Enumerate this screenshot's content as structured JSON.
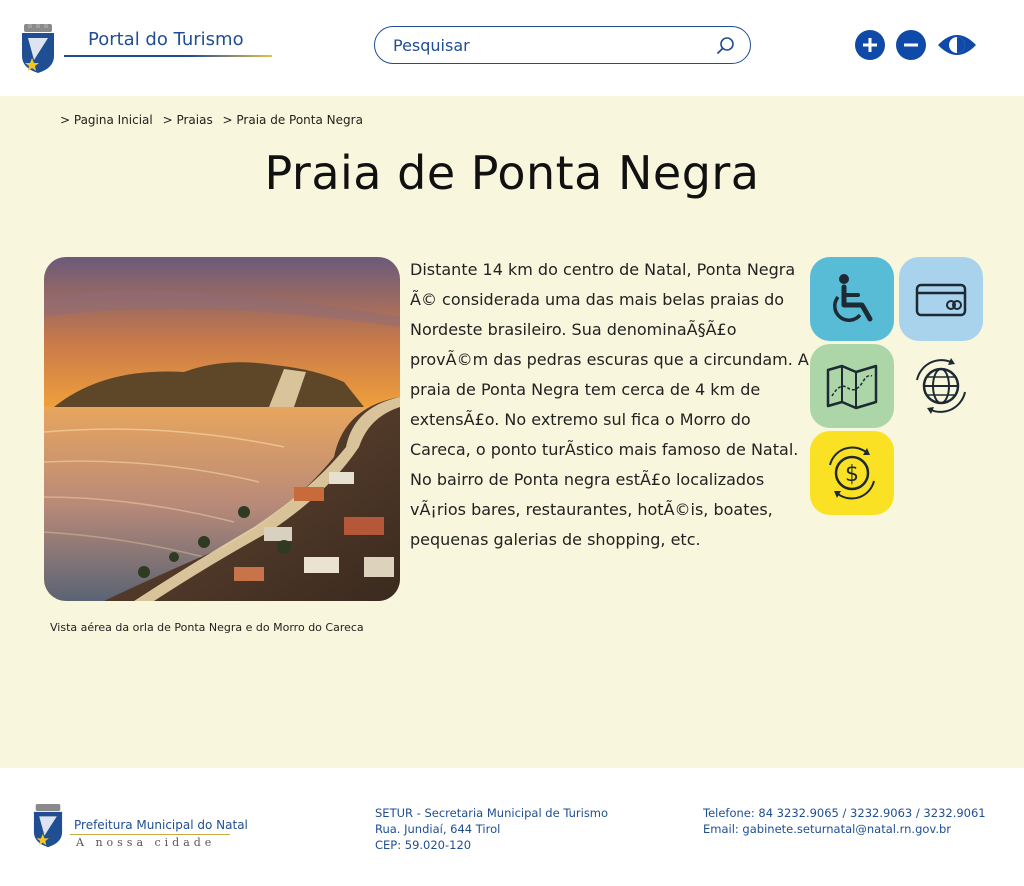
{
  "header": {
    "site_title": "Portal do Turismo",
    "search_placeholder": "Pesquisar",
    "controls": {
      "increase_font": "plus-icon",
      "decrease_font": "minus-icon",
      "contrast": "eye-icon"
    }
  },
  "breadcrumb": [
    "> Pagina Inicial",
    "> Praias",
    "> Praia de Ponta Negra"
  ],
  "page": {
    "title": "Praia de Ponta Negra",
    "description": "Distante 14 km do centro de Natal, Ponta Negra Ã© considerada uma das mais belas praias do Nordeste brasileiro. Sua denominaÃ§Ã£o provÃ©m das pedras escuras que a circundam. A praia de Ponta Negra tem cerca de 4 km de extensÃ£o. No extremo sul fica o Morro do Careca, o ponto turÃstico mais famoso de Natal. No bairro de Ponta negra estÃ£o localizados vÃ¡rios bares, restaurantes, hotÃ©is, boates, pequenas galerias de shopping, etc.",
    "photo_caption": "Vista aérea da orla de Ponta Negra e do Morro do Careca"
  },
  "feature_icons": [
    {
      "name": "accessibility-icon",
      "color": "#59bcd7"
    },
    {
      "name": "credit-card-icon",
      "color": "#a9d3ec"
    },
    {
      "name": "map-icon",
      "color": "#acd6a7"
    },
    {
      "name": "globe-icon",
      "color": "#f8f6dc"
    },
    {
      "name": "money-icon",
      "color": "#fbe124"
    }
  ],
  "footer": {
    "org_name": "Prefeitura Municipal do Natal",
    "org_tagline": "A nossa cidade",
    "address_lines": [
      "SETUR - Secretaria Municipal de Turismo",
      "Rua. Jundiaí, 644 Tirol",
      "CEP: 59.020-120"
    ],
    "contact_lines": [
      "Telefone: 84 3232.9065 / 3232.9063 / 3232.9061",
      "Email: gabinete.seturnatal@natal.rn.gov.br"
    ]
  },
  "colors": {
    "brand_blue": "#1f4e93",
    "button_blue": "#0f4aa8",
    "main_background": "#f8f6dc",
    "accent_gold": "#e8c24a"
  }
}
